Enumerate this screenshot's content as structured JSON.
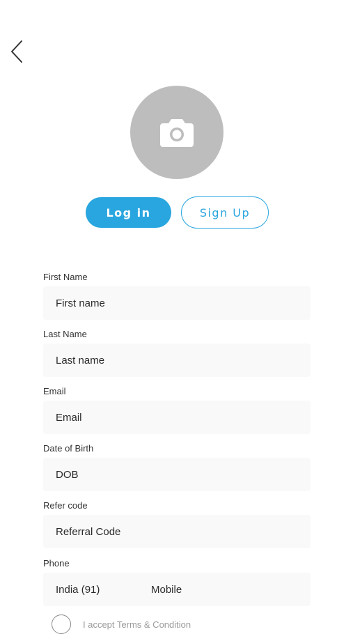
{
  "header": {
    "back_icon": "chevron-left-icon"
  },
  "avatar": {
    "icon": "camera-icon",
    "bg_color": "#bdbdbd"
  },
  "auth": {
    "login_label": "Log in",
    "signup_label": "Sign Up",
    "accent_color": "#29a6df"
  },
  "form": {
    "first_name": {
      "label": "First Name",
      "placeholder": "First name"
    },
    "last_name": {
      "label": "Last Name",
      "placeholder": "Last name"
    },
    "email": {
      "label": "Email",
      "placeholder": "Email"
    },
    "dob": {
      "label": "Date of Birth",
      "placeholder": "DOB"
    },
    "refer": {
      "label": "Refer code",
      "placeholder": "Referral Code"
    },
    "phone": {
      "label": "Phone",
      "country": "India (91)",
      "placeholder": "Mobile"
    }
  },
  "terms": {
    "text": "I accept Terms & Condition"
  }
}
